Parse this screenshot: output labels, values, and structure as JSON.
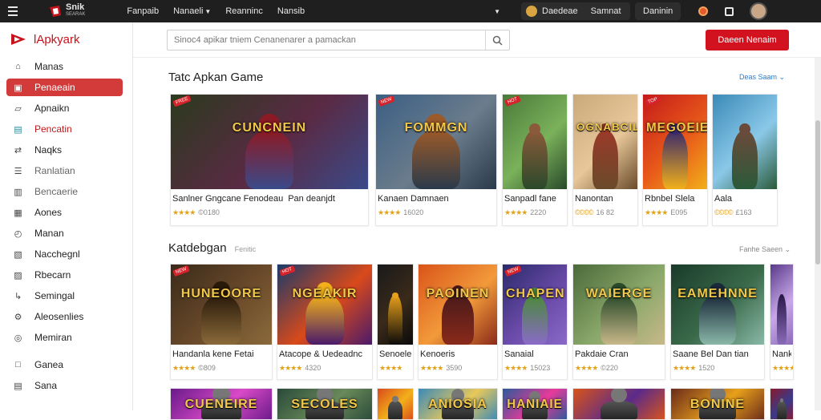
{
  "topbar": {
    "brand_title": "Snik",
    "brand_sub": "SEARAK",
    "nav": [
      "Fanpaib",
      "Nanaeli",
      "Reanninc",
      "Nansib"
    ],
    "account_name": "Daedeae",
    "account_status": "Samnat",
    "account_button": "Daninin"
  },
  "sidebar": {
    "title": "lApkyark",
    "items": [
      {
        "label": "Manas",
        "icon": "home-icon",
        "style": "normal"
      },
      {
        "label": "Penaeain",
        "icon": "flame-icon",
        "style": "active"
      },
      {
        "label": "Apnaikn",
        "icon": "thumb-icon",
        "style": "normal"
      },
      {
        "label": "Pencatin",
        "icon": "grid-icon",
        "style": "red"
      },
      {
        "label": "Naqks",
        "icon": "shuffle-icon",
        "style": "normal"
      },
      {
        "label": "Ranlatian",
        "icon": "category-icon",
        "style": "muted"
      },
      {
        "label": "Bencaerie",
        "icon": "clipboard-icon",
        "style": "muted"
      },
      {
        "label": "Aones",
        "icon": "calendar-icon",
        "style": "normal"
      },
      {
        "label": "Manan",
        "icon": "clock-icon",
        "style": "normal"
      },
      {
        "label": "Nacchegnl",
        "icon": "download-icon",
        "style": "normal"
      },
      {
        "label": "Rbecarn",
        "icon": "box-icon",
        "style": "normal"
      },
      {
        "label": "Semingal",
        "icon": "gesture-icon",
        "style": "normal"
      },
      {
        "label": "Aleosenlies",
        "icon": "gear-icon",
        "style": "normal"
      },
      {
        "label": "Memiran",
        "icon": "settings-icon",
        "style": "normal"
      },
      {
        "label": "Ganea",
        "icon": "square-icon",
        "style": "normal"
      },
      {
        "label": "Sana",
        "icon": "doc-icon",
        "style": "normal"
      }
    ]
  },
  "search": {
    "placeholder": "Sinoc4 apikar tniem Cenanenarer a pamackan",
    "cta": "Daeen Nenaim"
  },
  "section1": {
    "title": "Tatc Apkan Game",
    "see_all": "Deas Saam",
    "cards": [
      {
        "name": "Sanlner Gngcane Fenodeau",
        "extra": "Pan deanjdt",
        "rating": "★★★★",
        "count": "©0180",
        "palette": [
          "#2b3a1e",
          "#5a2a44",
          "#8b1a24",
          "#3a4a8a"
        ],
        "logo": "CUNCNEIN",
        "badge": "FREE"
      },
      {
        "name": "Kanaen Damnaen",
        "rating": "★★★★",
        "count": "16020",
        "palette": [
          "#3b5f84",
          "#6b7c8c",
          "#9a5a2a",
          "#2a3a4a"
        ],
        "logo": "FOMMGN",
        "badge": "NEW"
      },
      {
        "name": "Sanpadl fane",
        "rating": "★★★★",
        "count": "2220",
        "palette": [
          "#4a7a3a",
          "#7ab15a",
          "#8a5a3a",
          "#2a4a2a"
        ],
        "logo": "",
        "badge": "HOT"
      },
      {
        "name": "Nanontan",
        "rating": "©©©©",
        "count": "16 82",
        "palette": [
          "#c9a87a",
          "#e8c89a",
          "#9a3a2a",
          "#6a4a2a"
        ],
        "logo": "OGNABCIL",
        "badge": ""
      },
      {
        "name": "Rbnbel Slela",
        "rating": "★★★★",
        "count": "E095",
        "palette": [
          "#c41a1a",
          "#e85a1a",
          "#3a2a6a",
          "#f2b01a"
        ],
        "logo": "MEGOEIE",
        "badge": "TOP"
      },
      {
        "name": "Aala",
        "rating": "©©©©",
        "count": "£163",
        "palette": [
          "#3a8ab8",
          "#8ac8e8",
          "#6a4a3a",
          "#2a5a3a"
        ],
        "logo": "",
        "badge": ""
      }
    ]
  },
  "section2": {
    "title": "Katdebgan",
    "subtitle": "Fenitic",
    "see_all": "Fanhe Saeen",
    "cards": [
      {
        "name": "Handanla kene Fetai",
        "rating": "★★★★",
        "count": "©809",
        "palette": [
          "#3a2a1a",
          "#6a4a2a",
          "#2a1a0a",
          "#8a6a3a"
        ],
        "logo": "HUNEOORE",
        "badge": "NEW"
      },
      {
        "name": "Atacope & Uedeadnc",
        "rating": "★★★★",
        "count": "4320",
        "palette": [
          "#1a3a6a",
          "#d94a1a",
          "#f2b01a",
          "#4a1a6a"
        ],
        "logo": "NGEAKIR",
        "badge": "HOT"
      },
      {
        "name": "Senoele",
        "rating": "★★★★",
        "count": "",
        "palette": [
          "#1a1a1a",
          "#3a2a1a",
          "#e8a01a",
          "#0a0a0a"
        ],
        "logo": "",
        "badge": ""
      },
      {
        "name": "Kenoeris",
        "rating": "★★★★",
        "count": "3590",
        "palette": [
          "#d9541a",
          "#f29a3a",
          "#4a1a1a",
          "#8a2a1a"
        ],
        "logo": "PAOINEN",
        "badge": ""
      },
      {
        "name": "Sanaial",
        "rating": "★★★★",
        "count": "15023",
        "palette": [
          "#2a2a6a",
          "#6a4aa8",
          "#4a8a3a",
          "#8a6ac8"
        ],
        "logo": "CHAPEN",
        "badge": "NEW"
      },
      {
        "name": "Pakdaie Cran",
        "rating": "★★★★",
        "count": "©220",
        "palette": [
          "#4a6a3a",
          "#8aa86a",
          "#2a4a2a",
          "#c8b88a"
        ],
        "logo": "WAIERGE",
        "badge": ""
      },
      {
        "name": "Saane Bel Dan tian",
        "rating": "★★★★",
        "count": "1520",
        "palette": [
          "#1a3a2a",
          "#3a6a4a",
          "#1a2a3a",
          "#8ab8a8"
        ],
        "logo": "EAMEHNNE",
        "badge": ""
      },
      {
        "name": "Nanks",
        "rating": "★★★★",
        "count": "",
        "palette": [
          "#5a3a8a",
          "#c8a8e8",
          "#2a1a4a",
          "#8a6ab8"
        ],
        "logo": "",
        "badge": ""
      }
    ]
  },
  "section3": {
    "cards": [
      {
        "palette": [
          "#6a1a8a",
          "#d94ac8"
        ],
        "logo": "CUENEIRE"
      },
      {
        "palette": [
          "#2a4a3a",
          "#6a8a5a"
        ],
        "logo": "SECOLES"
      },
      {
        "palette": [
          "#d94a1a",
          "#f2b01a"
        ],
        "logo": ""
      },
      {
        "palette": [
          "#3a8ab8",
          "#e8c85a"
        ],
        "logo": "ANIOSIA"
      },
      {
        "palette": [
          "#2a5a9a",
          "#e83a9a"
        ],
        "logo": "HANIAIE"
      },
      {
        "palette": [
          "#d9541a",
          "#5a2a8a"
        ],
        "logo": ""
      },
      {
        "palette": [
          "#6a2a1a",
          "#e8a01a"
        ],
        "logo": "BONINE"
      },
      {
        "palette": [
          "#8a1a2a",
          "#3a3a8a"
        ],
        "logo": ""
      }
    ]
  }
}
